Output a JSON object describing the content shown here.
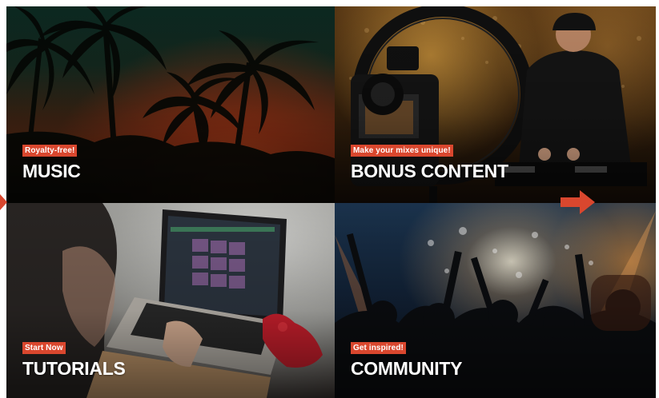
{
  "tiles": [
    {
      "badge": "Royalty-free!",
      "title": "MUSIC"
    },
    {
      "badge": "Make your mixes unique!",
      "title": "BONUS CONTENT"
    },
    {
      "badge": "Start Now",
      "title": "TUTORIALS"
    },
    {
      "badge": "Get inspired!",
      "title": "COMMUNITY"
    }
  ],
  "colors": {
    "badge_bg": "#d9472e",
    "arrow": "#d9472e",
    "title_text": "#ffffff"
  },
  "icons": {
    "prev": "arrow-left-icon",
    "next": "arrow-right-icon"
  }
}
